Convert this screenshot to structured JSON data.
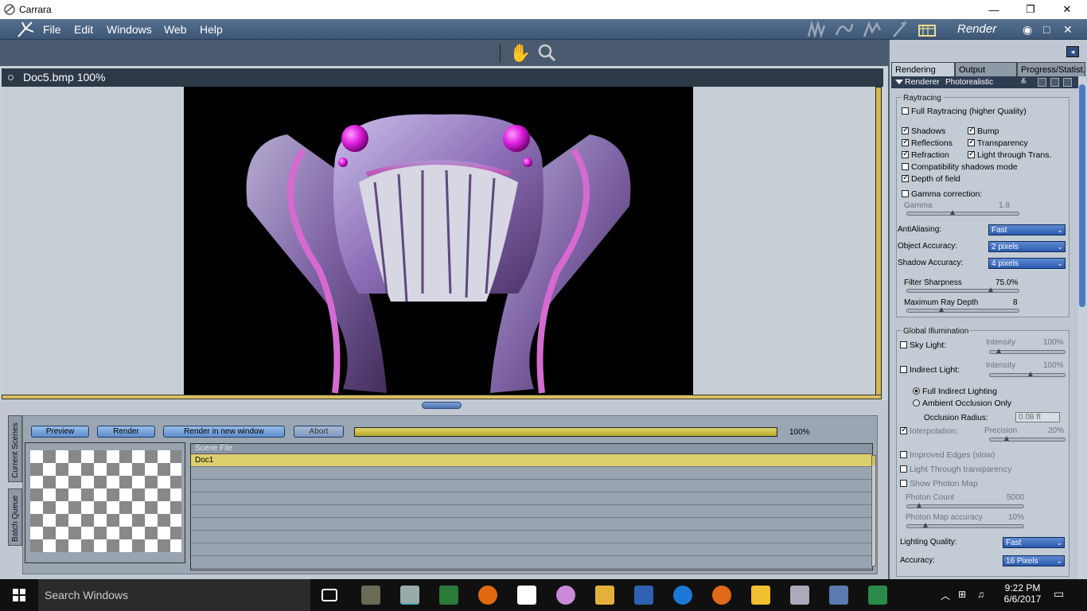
{
  "window": {
    "title": "Carrara",
    "min": "—",
    "restore": "❐",
    "close": "✕"
  },
  "menu": [
    "File",
    "Edit",
    "Windows",
    "Web",
    "Help"
  ],
  "room_name": "Render",
  "document": {
    "title": "Doc5.bmp 100%"
  },
  "controls": {
    "preview": "Preview",
    "render": "Render",
    "render_new": "Render in new window",
    "abort": "Abort",
    "progress": 100,
    "progress_label": "100%"
  },
  "side_tabs": {
    "current": "Current Scenes",
    "batch": "Batch Queue"
  },
  "scene_table": {
    "header": "Scene File",
    "rows": [
      "Doc1",
      "",
      "",
      "",
      "",
      "",
      "",
      "",
      ""
    ]
  },
  "panel": {
    "tabs": [
      "Rendering",
      "Output",
      "Progress/Statist."
    ],
    "renderer_label": "Renderer",
    "renderer_value": "Photorealistic",
    "raytracing": {
      "title": "Raytracing",
      "full": "Full Raytracing (higher Quality)",
      "shadows": "Shadows",
      "bump": "Bump",
      "reflections": "Reflections",
      "transparency": "Transparency",
      "refraction": "Refraction",
      "light_trans": "Light through Trans.",
      "compat": "Compatibility shadows mode",
      "dof": "Depth of field",
      "gamma_corr": "Gamma correction:",
      "gamma": "Gamma",
      "gamma_val": "1.8",
      "aa_label": "AntiAliasing:",
      "aa_val": "Fast",
      "obj_label": "Object Accuracy:",
      "obj_val": "2 pixels",
      "shadow_label": "Shadow Accuracy:",
      "shadow_val": "4 pixels",
      "filter_label": "Filter Sharpness",
      "filter_val": "75.0%",
      "filter_level": 0.75,
      "raydepth_label": "Maximum Ray Depth",
      "raydepth_val": "8"
    },
    "gi": {
      "title": "Global Illumination",
      "sky": "Sky Light:",
      "intensity": "Intensity",
      "intensity_val": "100%",
      "indirect": "Indirect Light:",
      "full_indirect": "Full Indirect Lighting",
      "ambient": "Ambient Occlusion Only",
      "occ_label": "Occlusion Radius:",
      "occ_val": "0.08 ft",
      "interp": "Interpolation:",
      "precision": "Precision",
      "precision_val": "20%",
      "improved": "Improved Edges (slow)",
      "light_transp": "Light Through transparency",
      "photon_map": "Show Photon Map",
      "photon_count": "Photon Count",
      "photon_count_val": "5000",
      "photon_acc": "Photon Map accuracy",
      "photon_acc_val": "10%",
      "lq_label": "Lighting Quality:",
      "lq_val": "Fast",
      "acc_label": "Accuracy:",
      "acc_val": "16 Pixels"
    }
  },
  "taskbar": {
    "search": "Search Windows",
    "time": "9:22 PM",
    "date": "6/6/2017"
  },
  "colors": {
    "menubar": "#3d5676",
    "accent": "#5f8ad0",
    "progress": "#cdbf46"
  }
}
